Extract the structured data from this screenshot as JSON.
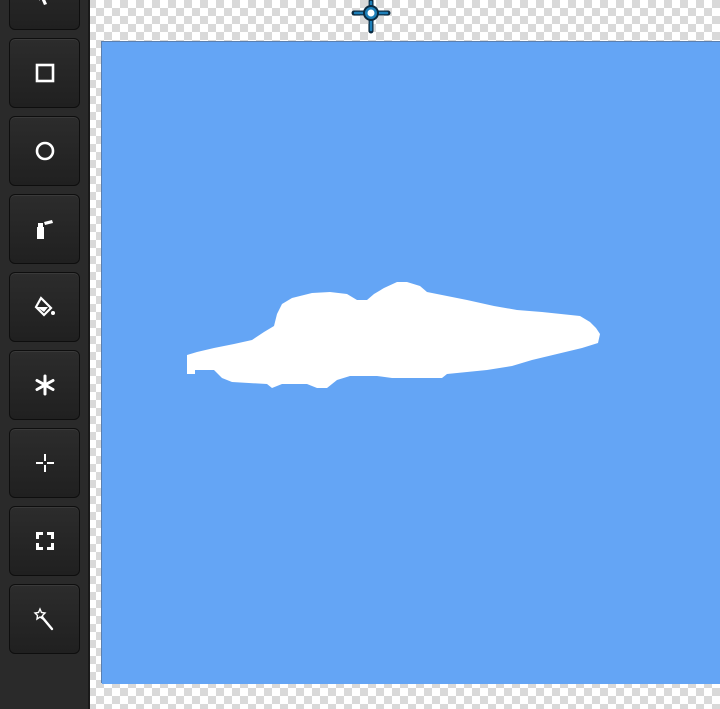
{
  "toolbar": {
    "tools": [
      {
        "id": "select",
        "icon": "arrow-cursor-icon"
      },
      {
        "id": "rectangle",
        "icon": "square-icon"
      },
      {
        "id": "ellipse",
        "icon": "circle-icon"
      },
      {
        "id": "spray",
        "icon": "spray-can-icon"
      },
      {
        "id": "fill",
        "icon": "paint-bucket-icon"
      },
      {
        "id": "stamp",
        "icon": "asterisk-icon"
      },
      {
        "id": "move",
        "icon": "crosshair-move-icon"
      },
      {
        "id": "marquee",
        "icon": "selection-marquee-icon"
      },
      {
        "id": "magic-wand",
        "icon": "magic-wand-icon"
      }
    ]
  },
  "canvas": {
    "sky_color": "#64a5f5",
    "cloud_color": "#ffffff",
    "transparency_pattern": "checkerboard"
  },
  "anchor": {
    "icon": "crosshair-target-icon",
    "color": "#1e7fb8"
  }
}
